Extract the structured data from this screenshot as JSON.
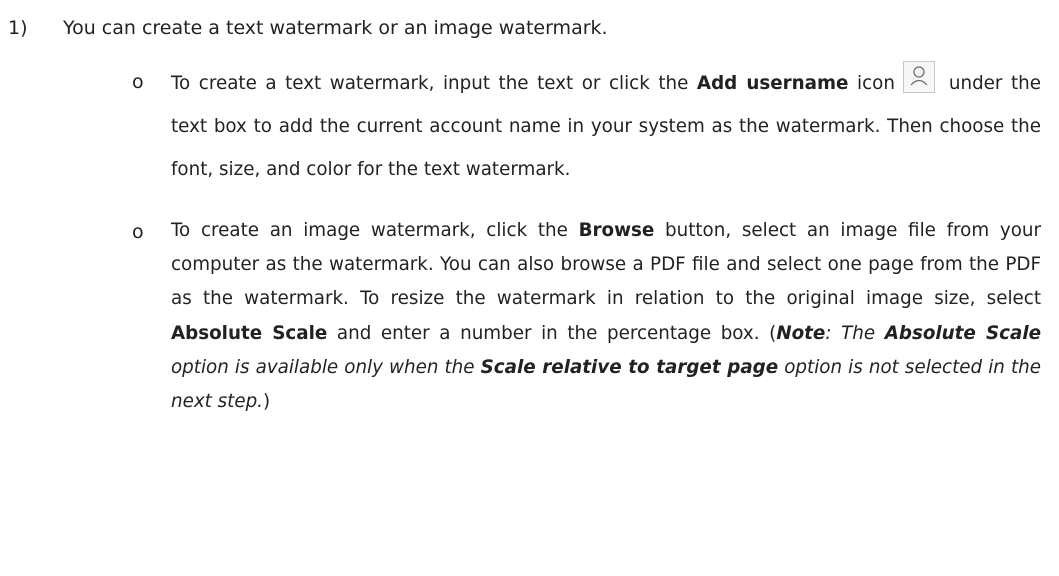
{
  "list_item": {
    "number": "1)",
    "text": "You can create a text watermark or an image watermark."
  },
  "bullets": [
    {
      "marker": "o",
      "text_segment": {
        "a": "To create a text watermark, input the text or click the ",
        "b": "Add username",
        "c": "icon",
        "d": "under the text box to add the current account name in your system as the watermark. Then choose the font, size, and color for the text watermark."
      },
      "icon": "user-icon"
    },
    {
      "marker": "o",
      "text_segment": {
        "a": "To create an image watermark, click the ",
        "b": "Browse",
        "c": " button, select an image file from your computer as the watermark. You can also browse a PDF file and select one page from the PDF as the watermark. To resize the watermark in relation to the original image size, select ",
        "d": "Absolute Scale",
        "e": " and enter a number in the percentage box. (",
        "f": "Note",
        "g": ": The ",
        "h": "Absolute Scale",
        "i": " option is available only when the ",
        "j": "Scale relative to target page",
        "k": " option is not selected in the next step.",
        "l": ")"
      }
    }
  ]
}
